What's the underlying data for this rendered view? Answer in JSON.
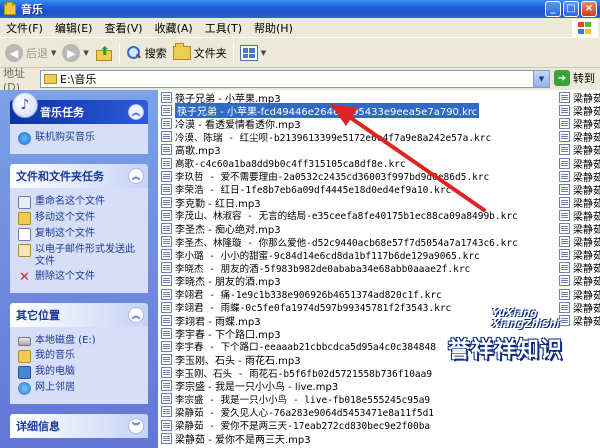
{
  "window": {
    "title": "音乐"
  },
  "menu": [
    "文件(F)",
    "编辑(E)",
    "查看(V)",
    "收藏(A)",
    "工具(T)",
    "帮助(H)"
  ],
  "toolbar": {
    "back": "后退",
    "search": "搜索",
    "folders": "文件夹"
  },
  "address": {
    "label": "地址(D)",
    "path": "E:\\音乐",
    "go": "转到"
  },
  "taskpane": {
    "music_tasks": {
      "title": "音乐任务",
      "items": [
        "联机购买音乐"
      ]
    },
    "file_tasks": {
      "title": "文件和文件夹任务",
      "items": [
        "重命名这个文件",
        "移动这个文件",
        "复制这个文件",
        "以电子邮件形式发送此文件",
        "删除这个文件"
      ]
    },
    "other_places": {
      "title": "其它位置",
      "items": [
        "本地磁盘 (E:)",
        "我的音乐",
        "我的电脑",
        "网上邻居"
      ]
    },
    "details": {
      "title": "详细信息"
    }
  },
  "files": [
    {
      "name": "筷子兄弟 - 小苹果.mp3",
      "mono": false
    },
    {
      "name": "筷子兄弟 - 小苹果-fcd49446e26461d95433e9eea5e7a790.krc",
      "mono": false,
      "selected": true
    },
    {
      "name": "冷漠 - 看透爱情看透你.mp3",
      "mono": false
    },
    {
      "name": "冷漠、陈瑞 - 红尘呗-b2139613399e5172e6e4f7a9e8a242e57a.krc",
      "mono": true
    },
    {
      "name": "高歌.mp3",
      "mono": false
    },
    {
      "name": "高歌-c4c60a1ba8dd9b0c4ff315105ca8df8e.krc",
      "mono": true
    },
    {
      "name": "李玖哲 - 爱不需要理由-2a0532c2435cd36003f997bd9d0e86d5.krc",
      "mono": true
    },
    {
      "name": "李荣浩 - 红日-1fe8b7eb6a09df4445e18d0ed4ef9a10.krc",
      "mono": true
    },
    {
      "name": "李克勤 - 红日.mp3",
      "mono": false
    },
    {
      "name": "李茂山、林淑容 - 无言的结局-e35ceefa8fe40175b1ec88ca09a8499b.krc",
      "mono": true
    },
    {
      "name": "李圣杰 - 痴心绝对.mp3",
      "mono": false
    },
    {
      "name": "李圣杰、林隆璇 - 你那么爱他-d52c9440acb68e57f7d5054a7a1743c6.krc",
      "mono": true
    },
    {
      "name": "李小璐 - 小小的甜蜜-9c84d14e6cd8da1bf117b6de129a9065.krc",
      "mono": true
    },
    {
      "name": "李晓杰 - 朋友的酒-5f983b982de0ababa34e68abb0aaae2f.krc",
      "mono": true
    },
    {
      "name": "李晓杰 - 朋友的酒.mp3",
      "mono": false
    },
    {
      "name": "李翊君 - 痛-1e9c1b338e906926b4651374ad820c1f.krc",
      "mono": true
    },
    {
      "name": "李翊君 - 雨蝶-0c5fe0fa1974d597b99345781f2f3543.krc",
      "mono": true
    },
    {
      "name": "李翊君 - 雨蝶.mp3",
      "mono": false
    },
    {
      "name": "李宇春 - 下个路口.mp3",
      "mono": false
    },
    {
      "name": "李宇春 - 下个路口-eeaaab21cbbcdca5d95a4c0c384848",
      "mono": true
    },
    {
      "name": "李玉刚、石头 - 雨花石.mp3",
      "mono": false
    },
    {
      "name": "李玉刚、石头 - 雨花石-b5f6fb02d5721558b736f10aa9",
      "mono": true
    },
    {
      "name": "李宗盛 - 我是一只小小鸟 - live.mp3",
      "mono": false
    },
    {
      "name": "李宗盛 - 我是一只小小鸟 - live-fb018e555245c95a9",
      "mono": true
    },
    {
      "name": "梁静茹 - 爱久见人心-76a283e9064d5453471e8a11f5d1",
      "mono": true
    },
    {
      "name": "梁静茹 - 爱你不是两三天-17eab272cd830bec9e2f00ba",
      "mono": true
    },
    {
      "name": "梁静茹 - 爱你不是两三天.mp3",
      "mono": false
    }
  ],
  "col2": [
    "梁静茹",
    "梁静茹",
    "梁静茹",
    "梁静茹",
    "梁静茹",
    "梁静茹",
    "梁静茹",
    "梁静茹",
    "梁静茹",
    "梁静茹",
    "梁静茹",
    "梁静茹",
    "梁静茹",
    "梁静茹",
    "梁静茹",
    "梁静茹",
    "梁静茹",
    "梁静茹"
  ],
  "watermark": {
    "en1": "YuXiang",
    "en2": "XiangZhiShi",
    "cn": "誉祥祥知识"
  },
  "colors": {
    "selection": "#316ac5",
    "arrow": "#e02424",
    "taskpane": "#7ba2e7"
  }
}
